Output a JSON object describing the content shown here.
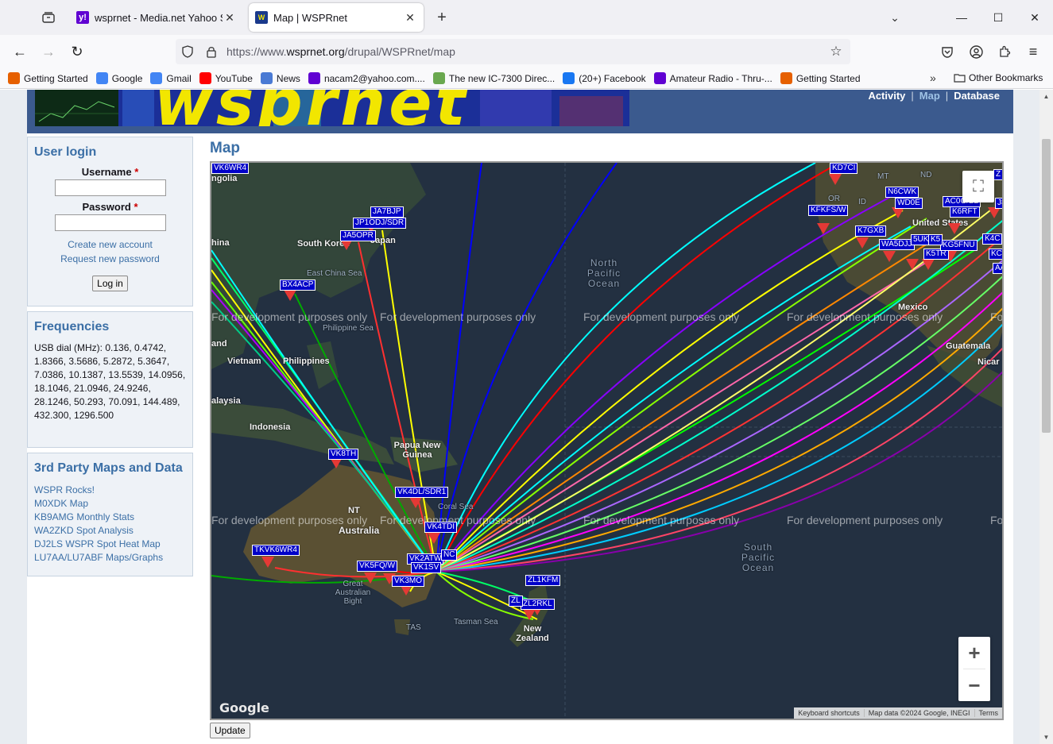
{
  "browser": {
    "tabs": [
      {
        "title": "wsprnet - Media.net Yahoo Sear",
        "favicon": "yahoo-icon",
        "active": false
      },
      {
        "title": "Map | WSPRnet",
        "favicon": "wsprnet-icon",
        "active": true
      }
    ],
    "url_prefix": "https://www.",
    "url_domain": "wsprnet.org",
    "url_path": "/drupal/WSPRnet/map",
    "bookmarks": [
      {
        "label": "Getting Started",
        "icon": "firefox-icon",
        "color": "#e66000"
      },
      {
        "label": "Google",
        "icon": "google-icon",
        "color": "#4285f4"
      },
      {
        "label": "Gmail",
        "icon": "google-icon",
        "color": "#4285f4"
      },
      {
        "label": "YouTube",
        "icon": "youtube-icon",
        "color": "#ff0000"
      },
      {
        "label": "News",
        "icon": "news-icon",
        "color": "#4a7ad4"
      },
      {
        "label": "nacam2@yahoo.com....",
        "icon": "yahoo-mail-icon",
        "color": "#6001d2"
      },
      {
        "label": "The new IC-7300 Direc...",
        "icon": "site-icon",
        "color": "#6aa84f"
      },
      {
        "label": "(20+) Facebook",
        "icon": "facebook-icon",
        "color": "#1877f2"
      },
      {
        "label": "Amateur Radio - Thru-...",
        "icon": "yahoo-icon",
        "color": "#6001d2"
      },
      {
        "label": "Getting Started",
        "icon": "firefox-icon",
        "color": "#e66000"
      }
    ],
    "other_bookmarks": "Other Bookmarks"
  },
  "site": {
    "banner_text": "wsprnet",
    "nav": [
      "Activity",
      "Map",
      "Database"
    ],
    "nav_current": "Map"
  },
  "login": {
    "title": "User login",
    "username_label": "Username",
    "password_label": "Password",
    "required_mark": "*",
    "create_account": "Create new account",
    "request_password": "Request new password",
    "login_button": "Log in"
  },
  "frequencies": {
    "title": "Frequencies",
    "text": "USB dial (MHz): 0.136, 0.4742, 1.8366, 3.5686, 5.2872, 5.3647, 7.0386, 10.1387, 13.5539, 14.0956, 18.1046, 21.0946, 24.9246, 28.1246, 50.293, 70.091, 144.489, 432.300, 1296.500"
  },
  "third_party": {
    "title": "3rd Party Maps and Data",
    "links": [
      "WSPR Rocks!",
      "M0XDK Map",
      "KB9AMG Monthly Stats",
      "WA2ZKD Spot Analysis",
      "DJ2LS WSPR Spot Heat Map",
      "LU7AA/LU7ABF Maps/Graphs"
    ]
  },
  "map": {
    "title": "Map",
    "watermark": "For development purposes only",
    "geo_labels": {
      "mongolia": "ngolia",
      "china": "hina",
      "south_korea": "South Korea",
      "japan": "Japan",
      "philippine_sea": "Philippine Sea",
      "vietnam": "Vietnam",
      "philippines": "Philippines",
      "malaysia": "alaysia",
      "indonesia": "Indonesia",
      "png": "Papua New Guinea",
      "coral_sea": "Coral Sea",
      "australia": "Australia",
      "nt": "NT",
      "tas": "TAS",
      "tasman_sea": "Tasman Sea",
      "great_australian_bight": "Great Australian Bight",
      "new_zealand": "New Zealand",
      "north_pacific": "North Pacific Ocean",
      "south_pacific": "South Pacific Ocean",
      "mexico": "Mexico",
      "guatemala": "Guatemala",
      "nicaragua": "Nicar",
      "united_states": "United States",
      "or": "OR",
      "id": "ID",
      "mt": "MT",
      "nd": "ND",
      "land": "and",
      "east_china_sea": "East China Sea"
    },
    "callsigns": [
      "JA7BJP",
      "JP1ODJ/SDR",
      "JA5OPR",
      "BX4ACP",
      "VK8TH",
      "VK4DL/SDR1",
      "VK4TDI",
      "VK6WR4",
      "VK5FQ/W",
      "VK2ATW",
      "VK1SV",
      "VK3MO",
      "ZL1KFM",
      "ZL2RKL",
      "NC",
      "ZL",
      "KFKFS/W",
      "K7GXB",
      "WA5DJJ",
      "K5TR",
      "KG5FNU",
      "N6CWK",
      "WD0E",
      "AC0G/B2",
      "K6RFT",
      "K4C",
      "5UK",
      "K5",
      "KC",
      "AA",
      "KD7CI",
      "Z",
      "J8",
      "TKVK6WR4"
    ],
    "google_logo": "Google",
    "attribution": [
      "Keyboard shortcuts",
      "Map data ©2024 Google, INEGI",
      "Terms"
    ],
    "zoom_in": "+",
    "zoom_out": "−",
    "update_button": "Update"
  }
}
